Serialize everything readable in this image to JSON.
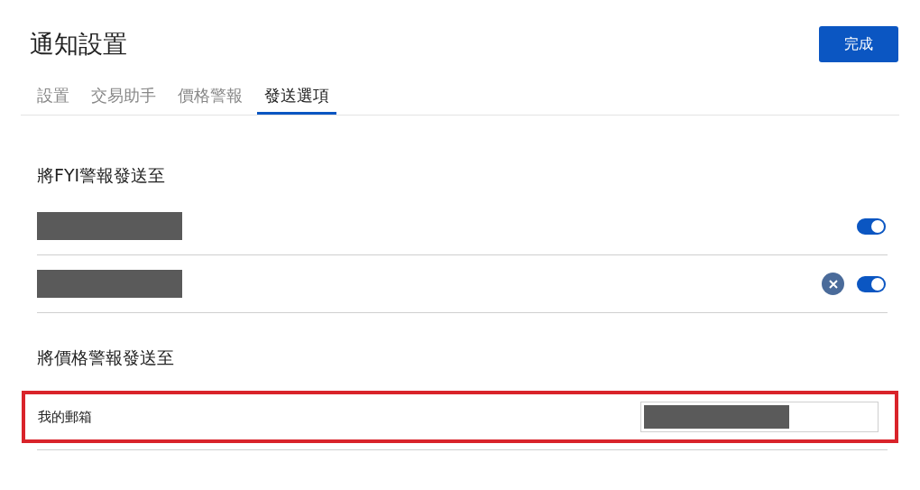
{
  "title": "通知設置",
  "done_button": "完成",
  "tabs": [
    {
      "label": "設置",
      "selected": false
    },
    {
      "label": "交易助手",
      "selected": false
    },
    {
      "label": "價格警報",
      "selected": false
    },
    {
      "label": "發送選項",
      "selected": true
    }
  ],
  "fyi_section": {
    "heading": "將FYI警報發送至",
    "rows": [
      {
        "on": true,
        "removable": false
      },
      {
        "on": true,
        "removable": true
      }
    ]
  },
  "price_section": {
    "heading": "將價格警報發送至",
    "email_label": "我的郵箱",
    "highlighted": true
  }
}
